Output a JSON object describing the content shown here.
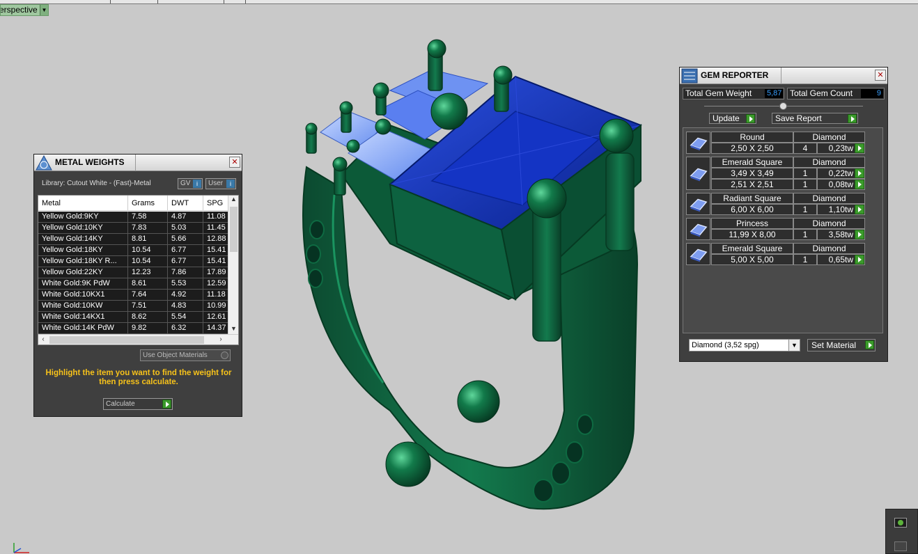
{
  "viewport": {
    "label": "erspective"
  },
  "metal_weights": {
    "title": "METAL WEIGHTS",
    "library": "Library: Cutout White - (Fast)-Metal",
    "gv_label": "GV",
    "user_label": "User",
    "columns": [
      "Metal",
      "Grams",
      "DWT",
      "SPG"
    ],
    "rows": [
      [
        "Yellow Gold:9KY",
        "7.58",
        "4.87",
        "11.08"
      ],
      [
        "Yellow Gold:10KY",
        "7.83",
        "5.03",
        "11.45"
      ],
      [
        "Yellow Gold:14KY",
        "8.81",
        "5.66",
        "12.88"
      ],
      [
        "Yellow Gold:18KY",
        "10.54",
        "6.77",
        "15.41"
      ],
      [
        "Yellow Gold:18KY R...",
        "10.54",
        "6.77",
        "15.41"
      ],
      [
        "Yellow Gold:22KY",
        "12.23",
        "7.86",
        "17.89"
      ],
      [
        "White Gold:9K PdW",
        "8.61",
        "5.53",
        "12.59"
      ],
      [
        "White Gold:10KX1",
        "7.64",
        "4.92",
        "11.18"
      ],
      [
        "White Gold:10KW",
        "7.51",
        "4.83",
        "10.99"
      ],
      [
        "White Gold:14KX1",
        "8.62",
        "5.54",
        "12.61"
      ],
      [
        "White Gold:14K PdW",
        "9.82",
        "6.32",
        "14.37"
      ]
    ],
    "use_object_materials": "Use Object Materials",
    "hint": "Highlight the item you want to find the weight for then press calculate.",
    "calculate": "Calculate"
  },
  "gem_reporter": {
    "title": "GEM REPORTER",
    "total_weight_label": "Total Gem Weight",
    "total_weight_value": "5,87",
    "total_count_label": "Total Gem Count",
    "total_count_value": "9",
    "update": "Update",
    "save_report": "Save Report",
    "groups": [
      {
        "shape": "Round",
        "material": "Diamond",
        "lines": [
          [
            "2,50 X 2,50",
            "4",
            "0,23tw"
          ]
        ]
      },
      {
        "shape": "Emerald Square",
        "material": "Diamond",
        "lines": [
          [
            "3,49 X 3,49",
            "1",
            "0,22tw"
          ],
          [
            "2,51 X 2,51",
            "1",
            "0,08tw"
          ]
        ]
      },
      {
        "shape": "Radiant Square",
        "material": "Diamond",
        "lines": [
          [
            "6,00 X 6,00",
            "1",
            "1,10tw"
          ]
        ]
      },
      {
        "shape": "Princess",
        "material": "Diamond",
        "lines": [
          [
            "11,99 X 8,00",
            "1",
            "3,58tw"
          ]
        ]
      },
      {
        "shape": "Emerald Square",
        "material": "Diamond",
        "lines": [
          [
            "5,00 X 5,00",
            "1",
            "0,65tw"
          ]
        ]
      }
    ],
    "material_select": "Diamond    (3,52 spg)",
    "set_material": "Set Material"
  },
  "colors": {
    "metal": "#0f5a3a",
    "gem_blue": "#0a2a9a",
    "gem_light": "#7fa8ff",
    "hint": "#f7c21a",
    "value_blue": "#3aa0ff"
  }
}
